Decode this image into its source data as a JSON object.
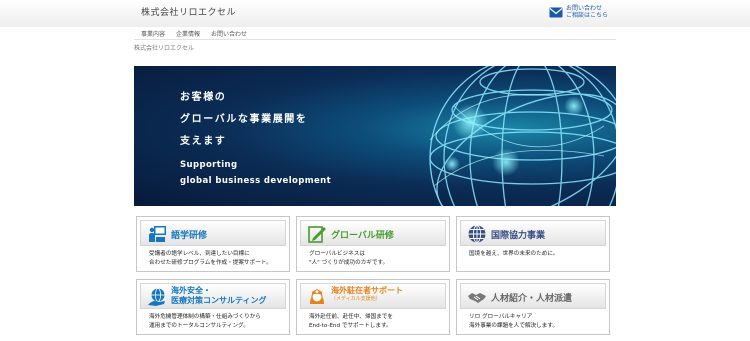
{
  "header": {
    "site_title": "株式会社リロエクセル",
    "contact_line1": "お問い合わせ",
    "contact_line2": "ご相談はこちら"
  },
  "nav": [
    "事業内容",
    "企業情報",
    "お問い合わせ"
  ],
  "breadcrumb": "株式会社リロエクセル",
  "hero": {
    "jp_line1": "お客様の",
    "jp_line2": "グローバルな事業展開を",
    "jp_line3": "支えます",
    "en_line1": "Supporting",
    "en_line2": "global business development"
  },
  "cards": [
    {
      "title": "語学研修",
      "desc1": "受講者の語学レベル、到達したい目標に",
      "desc2": "合わせた研修プログラムを作成・提案サポート。"
    },
    {
      "title": "グローバル研修",
      "desc1": "グローバルビジネスは",
      "desc2": "\"人\" づくりが成功のカギです。"
    },
    {
      "title": "国際協力事業",
      "desc1": "国境を越え、世界の未来のために。"
    },
    {
      "title_line1": "海外安全・",
      "title_line2": "医療対策コンサルティング",
      "desc1": "海外危機管理体制の構築・仕組みづくりから",
      "desc2": "運用までのトータルコンサルティング。"
    },
    {
      "title": "海外駐在者サポート",
      "subtitle": "（メディカル支援他）",
      "desc1": "海外赴任前、赴任中、帰国までを",
      "desc2": "End-to-End でサポートします。"
    },
    {
      "title": "人材紹介・人材派遣",
      "desc1": "リロ グローバルキャリア",
      "desc2": "海外事業の課題を人で解決します。"
    }
  ],
  "colors": {
    "blue": "#1577c0",
    "green": "#4a9a2e",
    "navy": "#3a4f86",
    "orange": "#e8821a",
    "gray": "#666666"
  },
  "icons": [
    "mail-icon",
    "teacher-icon",
    "pencil-icon",
    "globe-icon",
    "globe-hand-icon",
    "nurse-icon",
    "handshake-icon"
  ]
}
